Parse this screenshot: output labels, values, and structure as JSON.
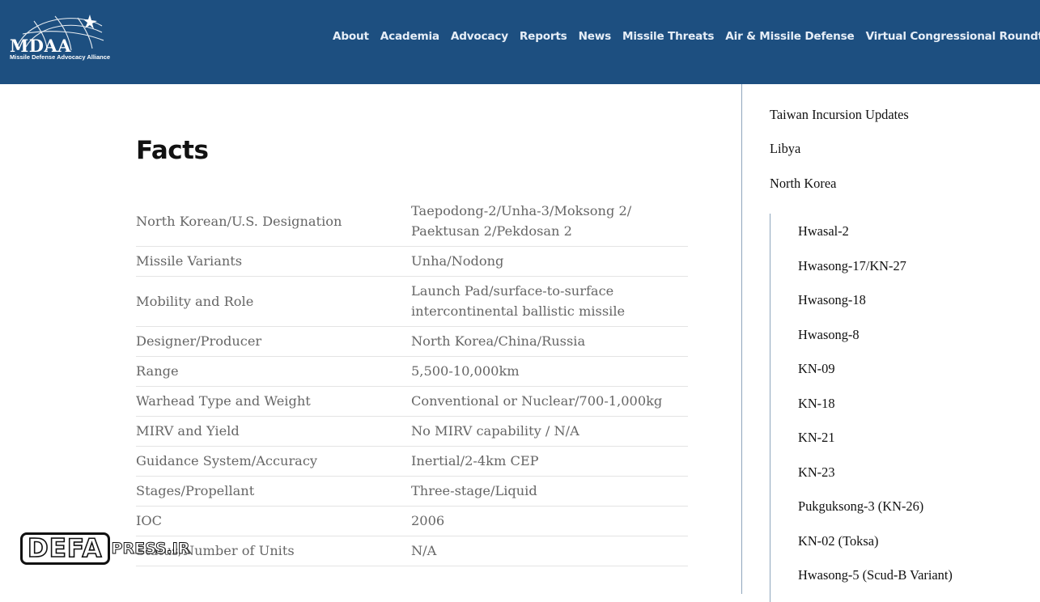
{
  "logo": {
    "name": "MDAA",
    "subtitle": "Missile Defense Advocacy Alliance"
  },
  "nav": [
    "About",
    "Academia",
    "Advocacy",
    "Reports",
    "News",
    "Missile Threats",
    "Air & Missile Defense",
    "Virtual Congressional Roundtables"
  ],
  "facts": {
    "title": "Facts",
    "rows": [
      {
        "key": "North Korean/U.S. Designation",
        "value": "Taepodong-2/Unha-3/Moksong 2/ Paektusan 2/Pekdosan 2"
      },
      {
        "key": "Missile Variants",
        "value": "Unha/Nodong"
      },
      {
        "key": "Mobility and Role",
        "value": "Launch Pad/surface-to-surface intercontinental ballistic missile"
      },
      {
        "key": "Designer/Producer",
        "value": "North Korea/China/Russia"
      },
      {
        "key": "Range",
        "value": "5,500-10,000km"
      },
      {
        "key": "Warhead Type and Weight",
        "value": "Conventional or Nuclear/700-1,000kg"
      },
      {
        "key": "MIRV and Yield",
        "value": "No MIRV capability / N/A"
      },
      {
        "key": "Guidance System/Accuracy",
        "value": "Inertial/2-4km CEP"
      },
      {
        "key": "Stages/Propellant",
        "value": "Three-stage/Liquid"
      },
      {
        "key": "IOC",
        "value": "2006"
      },
      {
        "key": "Status/Number of Units",
        "value": "N/A"
      }
    ]
  },
  "sidebar": {
    "top_links": [
      "Taiwan Incursion Updates",
      "Libya",
      "North Korea"
    ],
    "sub_links": [
      "Hwasal-2",
      "Hwasong-17/KN-27",
      "Hwasong-18",
      "Hwasong-8",
      "KN-09",
      "KN-18",
      "KN-21",
      "KN-23",
      "Pukguksong-3 (KN-26)",
      "KN-02 (Toksa)",
      "Hwasong-5 (Scud-B Variant)"
    ]
  },
  "watermark": {
    "brand": "DEFA",
    "suffix": "PRESS.IR"
  },
  "colors": {
    "header_bg": "#1d4f80",
    "nav_text": "#e6eef7",
    "divider": "#8fa6bd"
  }
}
